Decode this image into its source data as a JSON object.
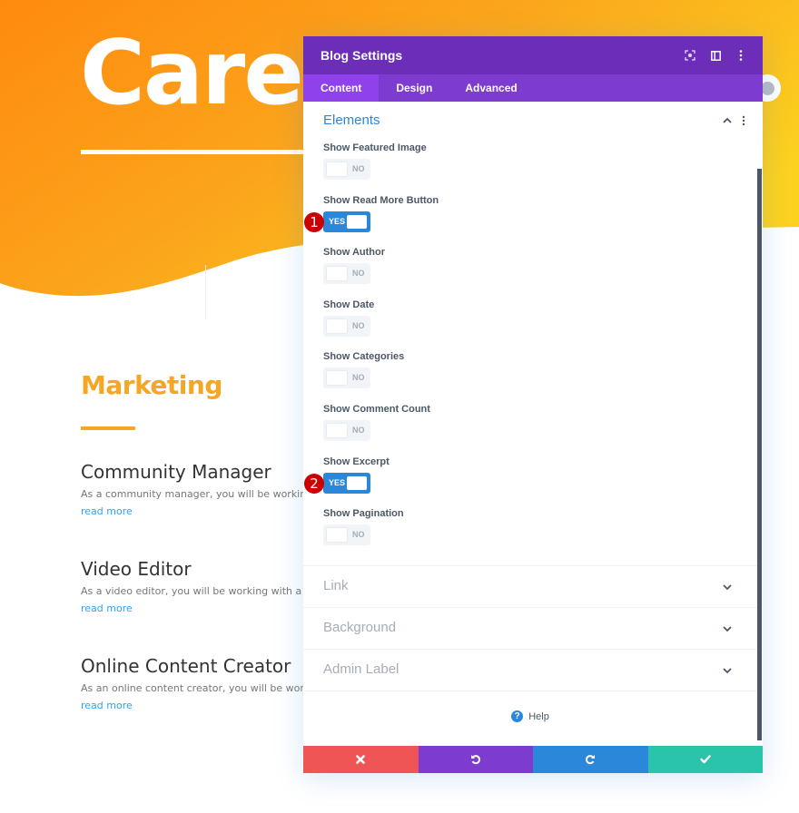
{
  "page": {
    "hero_title": "Careers",
    "section_title": "Marketing",
    "posts": [
      {
        "title": "Community Manager",
        "excerpt": "As a community manager, you will be working with",
        "read_more": "read more"
      },
      {
        "title": "Video Editor",
        "excerpt": "As a video editor, you will be working with a small",
        "read_more": "read more"
      },
      {
        "title": "Online Content Creator",
        "excerpt": "As an online content creator, you will be working v",
        "read_more": "read more"
      }
    ],
    "colors": {
      "hero_gradient_start": "#ff8a0e",
      "hero_gradient_mid": "#fba51c",
      "hero_gradient_end": "#fcd21f",
      "accent": "#f5a623",
      "link": "#2ea3f2"
    }
  },
  "modal": {
    "title": "Blog Settings",
    "header_icons": [
      "focus-icon",
      "sidebar-layout-icon",
      "more-vertical-icon"
    ],
    "tabs": [
      {
        "label": "Content",
        "active": true
      },
      {
        "label": "Design",
        "active": false
      },
      {
        "label": "Advanced",
        "active": false
      }
    ],
    "elements_group": {
      "title": "Elements",
      "expanded": true,
      "fields": [
        {
          "label": "Show Featured Image",
          "value": "NO",
          "on": false
        },
        {
          "label": "Show Read More Button",
          "value": "YES",
          "on": true,
          "badge": "1"
        },
        {
          "label": "Show Author",
          "value": "NO",
          "on": false
        },
        {
          "label": "Show Date",
          "value": "NO",
          "on": false
        },
        {
          "label": "Show Categories",
          "value": "NO",
          "on": false
        },
        {
          "label": "Show Comment Count",
          "value": "NO",
          "on": false
        },
        {
          "label": "Show Excerpt",
          "value": "YES",
          "on": true,
          "badge": "2"
        },
        {
          "label": "Show Pagination",
          "value": "NO",
          "on": false
        }
      ]
    },
    "closed_groups": [
      {
        "title": "Link"
      },
      {
        "title": "Background"
      },
      {
        "title": "Admin Label"
      }
    ],
    "help_label": "Help",
    "footer": {
      "discard": "close-icon",
      "undo": "undo-icon",
      "redo": "redo-icon",
      "save": "check-icon"
    },
    "colors": {
      "header": "#6c2eb9",
      "tabs": "#7d3bcf",
      "tab_active": "#8f42ec",
      "toggle_on": "#2b87da",
      "discard": "#ef5555",
      "undo": "#7e3bd0",
      "redo": "#2b87da",
      "save": "#29c4a9"
    }
  }
}
